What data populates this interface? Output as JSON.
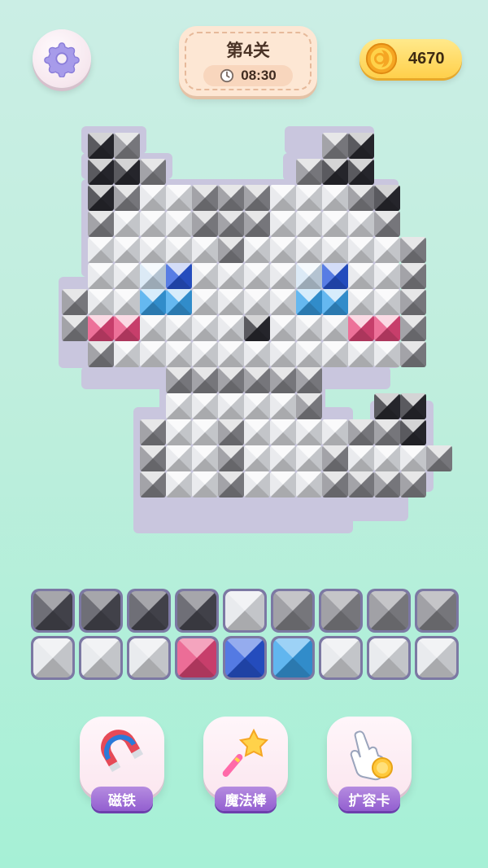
{
  "header": {
    "settings_icon": "gear-icon",
    "level_label": "第4关",
    "timer_icon": "clock-icon",
    "timer": "08:30",
    "coin_icon": "coin-icon",
    "coins": "4670"
  },
  "colors": {
    "K": "#2c2c33",
    "D": "#4c4c56",
    "G": "#8a8a90",
    "W": "#e4e6ea",
    "B": "#2a59dd",
    "L": "#3aa4ec",
    "C": "#d2e4f4",
    "P": "#e8497d",
    "outline": "#c9c6de"
  },
  "art": {
    "origin_col0": 108,
    "rows": [
      "KG.........GK",
      "KKG.......GKK",
      "KGWWGGGWWWGKK",
      "GWWWGGGWWWWGK",
      "WWWWWGWWWWWWG",
      "WWCBWWWWCBWWWG",
      "GWWLLWWWWLLWWG",
      "GPPWWWWKWWWPPWG",
      "GWWWWWWWWWWWWG",
      "...GGGGGGGG....",
      "....WWWWWWG....KK",
      "...GWWGWWWWG...GK",
      "...GWWGWWWGWWWWG",
      "...GWWGWWWGWGGG"
    ],
    "row_offsets": [
      0,
      0,
      0,
      0,
      0,
      0,
      0,
      -1,
      0,
      0,
      0,
      0,
      0,
      0
    ]
  },
  "palette": {
    "row1": [
      "D",
      "D",
      "D",
      "D",
      "W",
      "G",
      "G",
      "G",
      "G"
    ],
    "row2": [
      "W",
      "W",
      "W",
      "P",
      "B",
      "L",
      "W",
      "W",
      "W"
    ]
  },
  "powerups": [
    {
      "label": "磁铁",
      "icon": "magnet-icon"
    },
    {
      "label": "魔法棒",
      "icon": "magic-wand-icon"
    },
    {
      "label": "扩容卡",
      "icon": "expand-card-icon"
    }
  ]
}
